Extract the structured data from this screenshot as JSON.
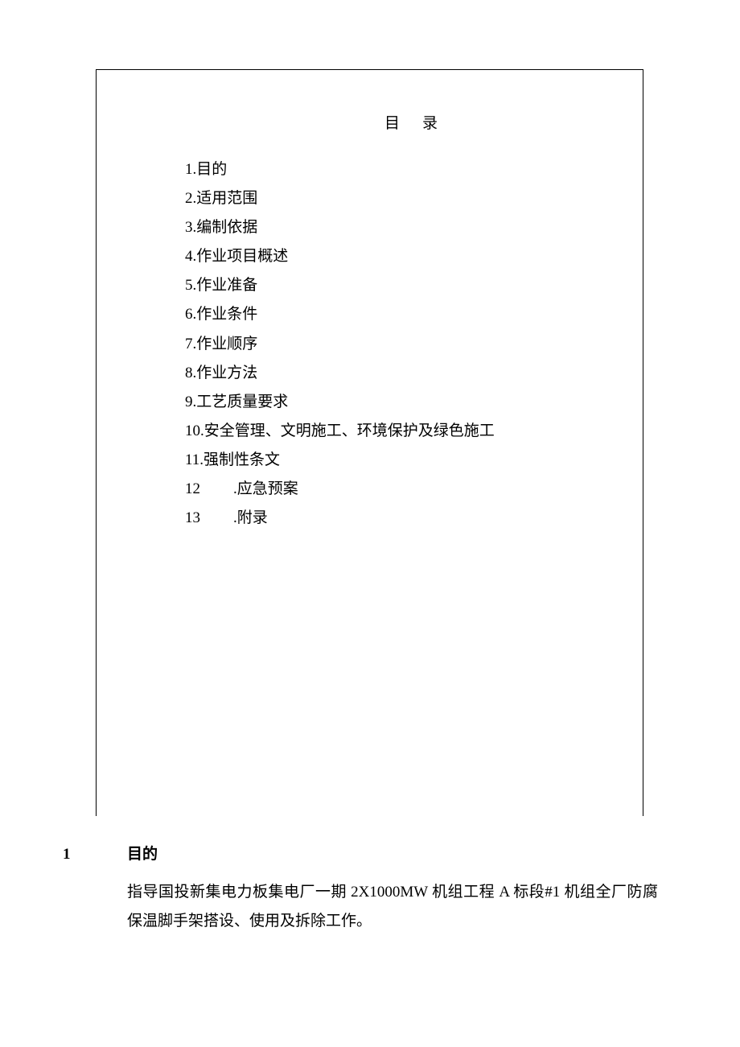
{
  "toc": {
    "title": "目录",
    "items": [
      "1.目的",
      "2.适用范围",
      "3.编制依据",
      "4.作业项目概述",
      "5.作业准备",
      "6.作业条件",
      "7.作业顺序",
      "8.作业方法",
      "9.工艺质量要求",
      "10.安全管理、文明施工、环境保护及绿色施工",
      "11.强制性条文"
    ],
    "splitItems": [
      {
        "num": "12",
        "label": ".应急预案"
      },
      {
        "num": "13",
        "label": ".附录"
      }
    ]
  },
  "section1": {
    "num": "1",
    "heading": "目的",
    "body": "指导国投新集电力板集电厂一期 2X1000MW 机组工程 A 标段#1 机组全厂防腐保温脚手架搭设、使用及拆除工作。"
  }
}
